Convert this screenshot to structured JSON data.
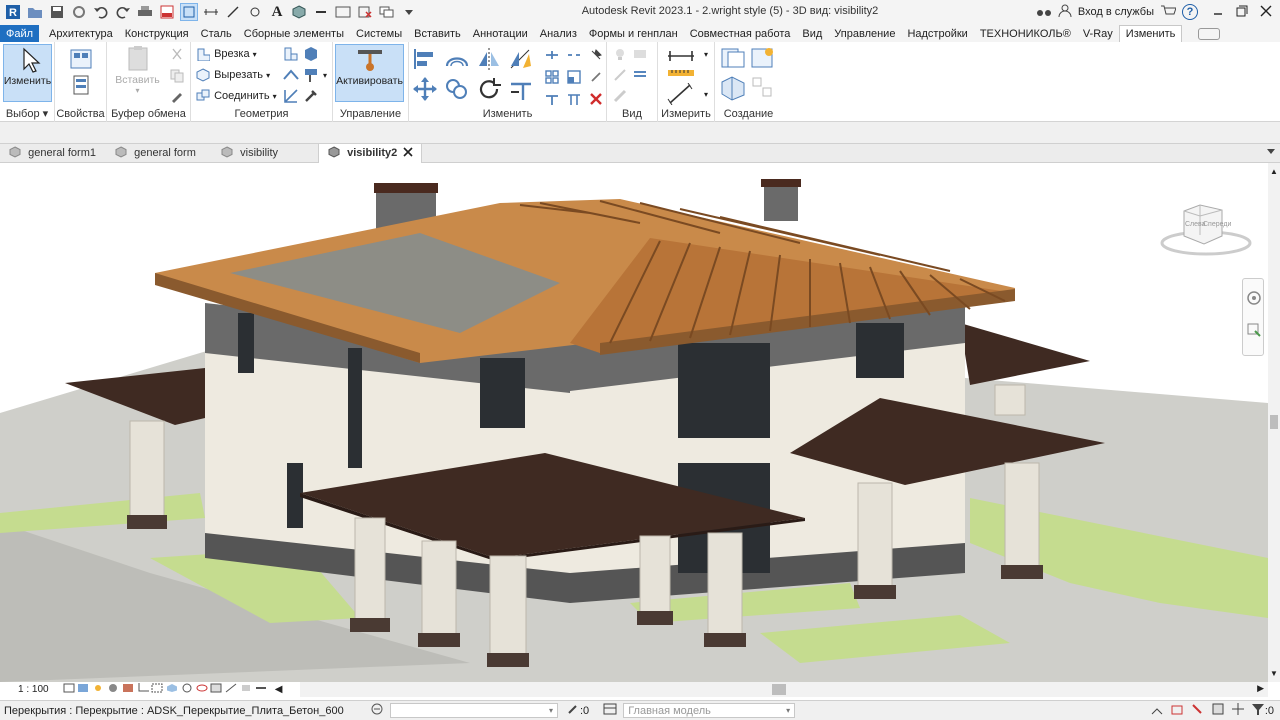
{
  "app": {
    "title": "Autodesk Revit 2023.1 - 2.wright style (5) - 3D вид: visibility2",
    "signin": "Вход в службы",
    "help": "?"
  },
  "ribbon_tabs": [
    {
      "label": "Файл"
    },
    {
      "label": "Архитектура"
    },
    {
      "label": "Конструкция"
    },
    {
      "label": "Сталь"
    },
    {
      "label": "Сборные элементы"
    },
    {
      "label": "Системы"
    },
    {
      "label": "Вставить"
    },
    {
      "label": "Аннотации"
    },
    {
      "label": "Анализ"
    },
    {
      "label": "Формы и генплан"
    },
    {
      "label": "Совместная работа"
    },
    {
      "label": "Вид"
    },
    {
      "label": "Управление"
    },
    {
      "label": "Надстройки"
    },
    {
      "label": "ТЕХНОНИКОЛЬ®"
    },
    {
      "label": "V-Ray"
    },
    {
      "label": "Изменить"
    }
  ],
  "ribbon": {
    "select": {
      "button": "Изменить",
      "label": "Выбор"
    },
    "properties": {
      "label": "Свойства"
    },
    "clipboard": {
      "paste": "Вставить",
      "label": "Буфер обмена"
    },
    "geometry": {
      "cope": "Врезка",
      "cut": "Вырезать",
      "join": "Соединить",
      "label": "Геометрия"
    },
    "control": {
      "activate": "Активировать",
      "label": "Управление"
    },
    "modify": {
      "label": "Изменить"
    },
    "view": {
      "label": "Вид"
    },
    "measure": {
      "label": "Измерить"
    },
    "create": {
      "label": "Создание"
    }
  },
  "view_tabs": [
    {
      "label": "general form1"
    },
    {
      "label": "general form"
    },
    {
      "label": "visibility"
    },
    {
      "label": "visibility2"
    }
  ],
  "viewcube": {
    "face_left": "Слева",
    "face_front": "Спереди"
  },
  "view_control": {
    "scale": "1 : 100"
  },
  "status": {
    "text": "Перекрытия : Перекрытие : ADSK_Перекрытие_Плита_Бетон_600",
    "count": ":0",
    "model": "Главная модель",
    "filter": ":0"
  },
  "colors": {
    "file_tab": "#1f6fc1",
    "selected_button": "#c9e0f7",
    "roof_wood": "#c98a4a",
    "roof_dark": "#3f2a22",
    "wall_stucco": "#eeeae0",
    "brick": "#5e5e5e",
    "lawn": "#c5dc8f",
    "ground": "#c9c9c4"
  }
}
